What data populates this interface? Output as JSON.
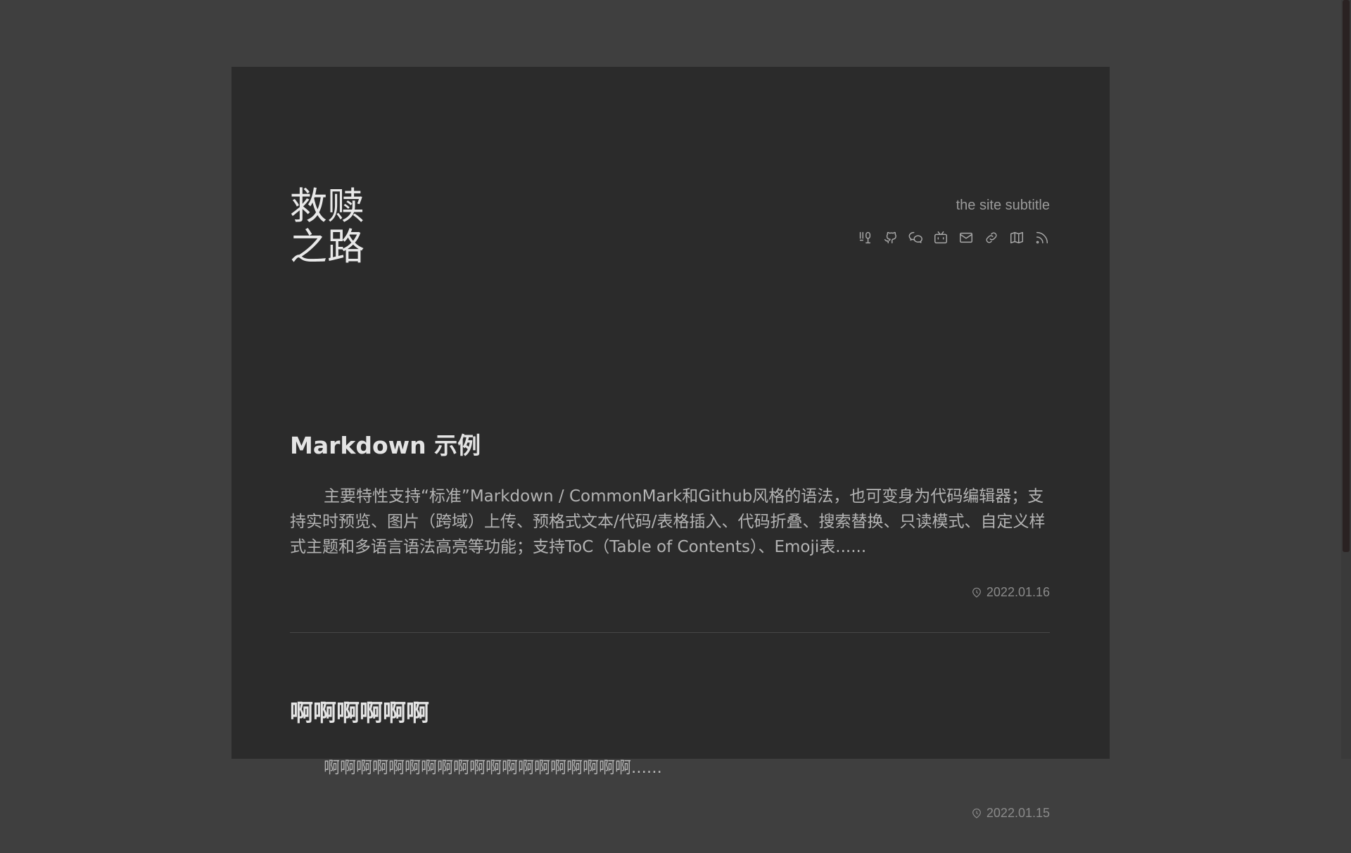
{
  "site": {
    "title_line1": "救赎",
    "title_line2": "之路",
    "subtitle": "the site subtitle"
  },
  "social_icons": [
    "douban-icon",
    "github-icon",
    "wechat-icon",
    "bilibili-icon",
    "mail-icon",
    "link-icon",
    "map-icon",
    "rss-icon"
  ],
  "posts": [
    {
      "title": "Markdown 示例",
      "excerpt": "主要特性支持“标准”Markdown / CommonMark和Github风格的语法，也可变身为代码编辑器；支持实时预览、图片（跨域）上传、预格式文本/代码/表格插入、代码折叠、搜索替换、只读模式、自定义样式主题和多语言语法高亮等功能；支持ToC（Table of Contents）、Emoji表......",
      "date": "2022.01.16"
    },
    {
      "title": "啊啊啊啊啊啊",
      "excerpt": "啊啊啊啊啊啊啊啊啊啊啊啊啊啊啊啊啊啊啊......",
      "date": "2022.01.15"
    }
  ],
  "colors": {
    "background": "#3f3f3f",
    "card": "#2b2b2b",
    "title": "#e8e8e8",
    "text": "#b4b4b4",
    "muted": "#8a8a8a"
  }
}
